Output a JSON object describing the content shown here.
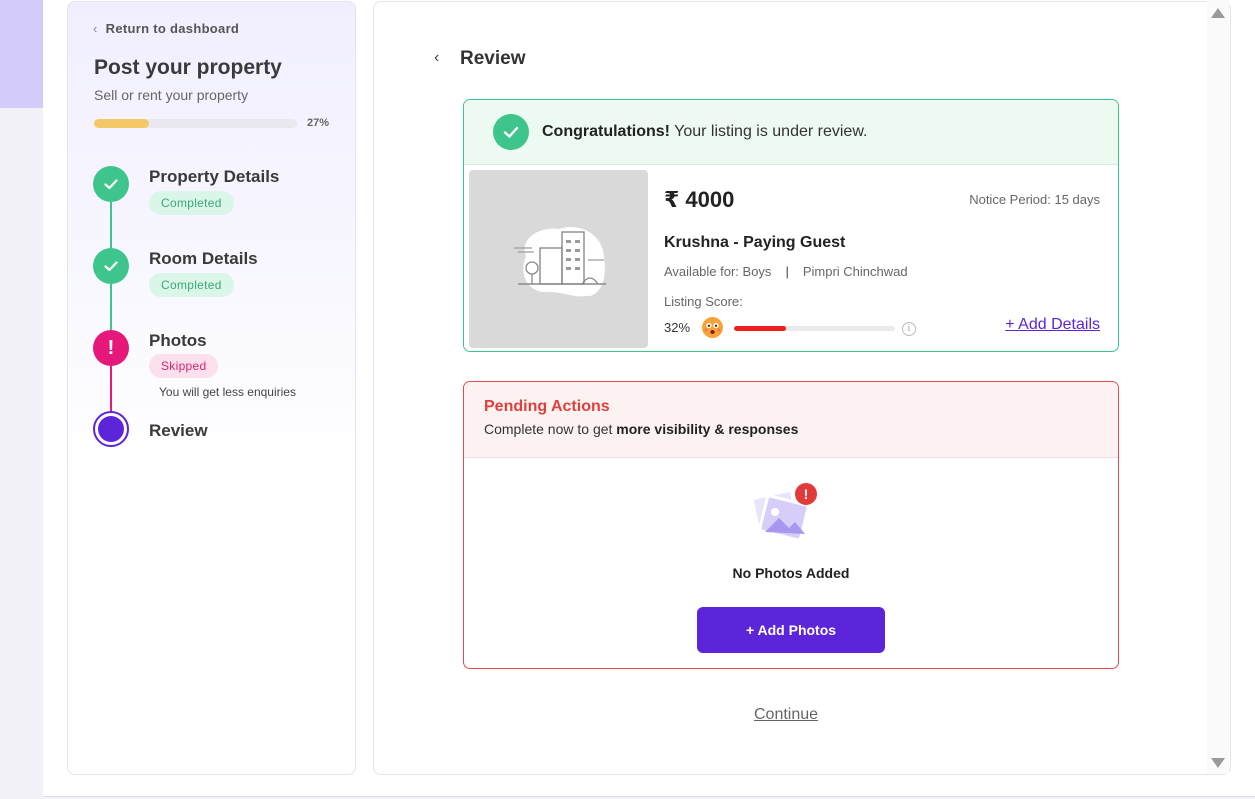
{
  "sidebar": {
    "back_label": "Return to dashboard",
    "title": "Post your property",
    "subtitle": "Sell or rent your property",
    "progress_value": 0.27,
    "progress_label": "27%",
    "steps": [
      {
        "label": "Property Details",
        "status": "Completed",
        "state": "done"
      },
      {
        "label": "Room Details",
        "status": "Completed",
        "state": "done"
      },
      {
        "label": "Photos",
        "status": "Skipped",
        "state": "skipped",
        "note": "You will get less enquiries"
      },
      {
        "label": "Review",
        "state": "current"
      }
    ]
  },
  "main": {
    "title": "Review",
    "congrats": {
      "bold": "Congratulations!",
      "text": "Your listing is under review."
    },
    "listing": {
      "price": "₹ 4000",
      "notice": "Notice Period: 15 days",
      "name": "Krushna - Paying Guest",
      "available_for": "Available for: Boys",
      "separator": "|",
      "location": "Pimpri Chinchwad",
      "score_label": "Listing Score:",
      "score_pct": "32%",
      "score_value": 0.32,
      "add_details": "+ Add Details"
    },
    "pending": {
      "title": "Pending Actions",
      "sub_prefix": "Complete now to get ",
      "sub_bold": "more visibility & responses",
      "empty_label": "No Photos Added",
      "button": "+ Add Photos"
    },
    "continue_label": "Continue"
  },
  "colors": {
    "accent": "#5c25d9",
    "success": "#3ec58b",
    "skipped": "#e6197b",
    "danger": "#e24b4b",
    "progress": "#f5c867",
    "score": "#ef1d1d"
  },
  "icons": [
    "chevron-left-icon",
    "check-icon",
    "exclamation-icon",
    "building-placeholder-icon",
    "sad-face-emoji-icon",
    "info-icon",
    "photo-warning-icon",
    "scroll-up-arrow-icon",
    "scroll-down-arrow-icon"
  ]
}
